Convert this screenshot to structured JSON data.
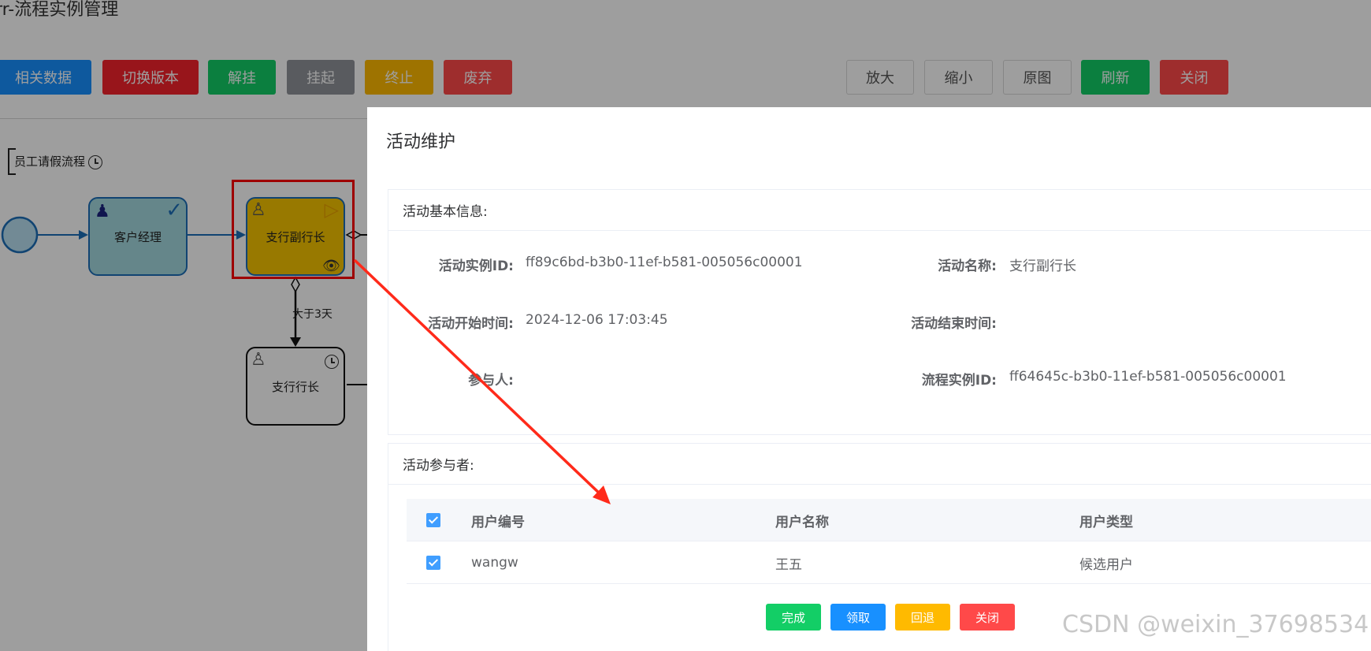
{
  "page": {
    "title": "rr-流程实例管理"
  },
  "toolbar_left": [
    {
      "label": "相关数据",
      "color": "#1890ff"
    },
    {
      "label": "切换版本",
      "color": "#f5222d"
    },
    {
      "label": "解挂",
      "color": "#13ce66"
    },
    {
      "label": "挂起",
      "color": "#909399"
    },
    {
      "label": "终止",
      "color": "#ffba00"
    },
    {
      "label": "废弃",
      "color": "#ff4949"
    }
  ],
  "toolbar_right": [
    {
      "label": "放大",
      "color": "#ffffff"
    },
    {
      "label": "缩小",
      "color": "#ffffff"
    },
    {
      "label": "原图",
      "color": "#ffffff"
    },
    {
      "label": "刷新",
      "color": "#13ce66"
    },
    {
      "label": "关闭",
      "color": "#ff4949"
    }
  ],
  "diagram": {
    "pool_label": "员工请假流程",
    "tasks": {
      "customer_manager": "客户经理",
      "vice_president": "支行副行长",
      "president": "支行行长"
    },
    "flow_label": "大于3天",
    "colors": {
      "completed": "#a4d9df",
      "active": "#f5c400",
      "highlight": "#ff0000",
      "pending": "#ffffff"
    }
  },
  "modal": {
    "title": "活动维护",
    "basic_info": {
      "header": "活动基本信息:",
      "fields": {
        "instance_id_label": "活动实例ID:",
        "instance_id": "ff89c6bd-b3b0-11ef-b581-005056c00001",
        "name_label": "活动名称:",
        "name": "支行副行长",
        "start_time_label": "活动开始时间:",
        "start_time": "2024-12-06 17:03:45",
        "end_time_label": "活动结束时间:",
        "end_time": "",
        "participant_label": "参与人:",
        "participant": "",
        "process_instance_id_label": "流程实例ID:",
        "process_instance_id": "ff64645c-b3b0-11ef-b581-005056c00001"
      }
    },
    "participants": {
      "header": "活动参与者:",
      "columns": [
        "用户编号",
        "用户名称",
        "用户类型"
      ],
      "rows": [
        {
          "user_id": "wangw",
          "user_name": "王五",
          "user_type": "候选用户",
          "checked": true
        }
      ]
    },
    "buttons": [
      {
        "label": "完成",
        "color": "#13ce66"
      },
      {
        "label": "领取",
        "color": "#1890ff"
      },
      {
        "label": "回退",
        "color": "#ffba00"
      },
      {
        "label": "关闭",
        "color": "#ff4949"
      }
    ]
  },
  "watermark": "CSDN @weixin_37698534",
  "annotation_arrow_color": "#ff2a1a"
}
